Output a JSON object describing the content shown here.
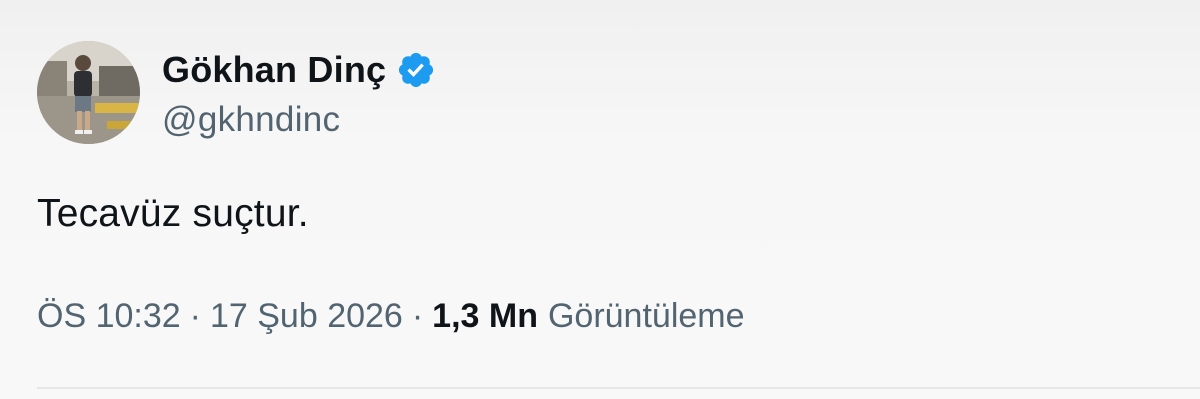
{
  "author": {
    "display_name": "Gökhan Dinç",
    "handle": "@gkhndinc",
    "verified": true,
    "avatar_icon": "profile-photo",
    "verified_icon": "verified-badge-icon",
    "verified_color": "#1d9bf0"
  },
  "tweet": {
    "text": "Tecavüz suçtur."
  },
  "meta": {
    "time": "ÖS 10:32",
    "separator": "·",
    "date": "17 Şub 2026",
    "views_count": "1,3 Mn",
    "views_label": "Görüntüleme"
  },
  "colors": {
    "text_primary": "#0f1419",
    "text_secondary": "#536471",
    "accent": "#1d9bf0"
  }
}
